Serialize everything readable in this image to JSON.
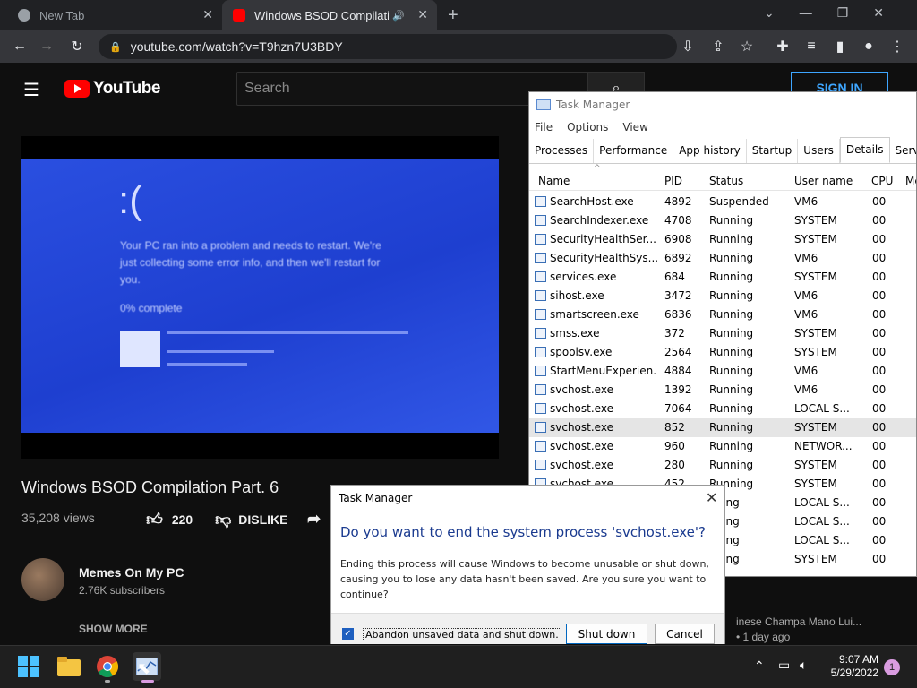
{
  "browser": {
    "tabs": [
      {
        "title": "New Tab",
        "close": "✕"
      },
      {
        "title": "Windows BSOD Compilation",
        "close": "✕"
      }
    ],
    "new_tab": "+",
    "address": "youtube.com/watch?v=T9hzn7U3BDY",
    "window_controls": [
      "⌄",
      "—",
      "❐",
      "✕"
    ]
  },
  "youtube": {
    "logo": "YouTube",
    "search_placeholder": "Search",
    "signin": "SIGN IN",
    "video_title": "Windows BSOD Compilation Part. 6",
    "views": "35,208 views",
    "likes": "220",
    "dislike": "DISLIKE",
    "channel": "Memes On My PC",
    "subscribers": "2.76K subscribers",
    "show_more": "SHOW MORE",
    "side_fragment_title": "inese Champa Mano Lui...",
    "side_fragment_age": "• 1 day ago",
    "bsod": {
      "face": ":(",
      "line1": "Your PC ran into a problem and needs to restart. We're",
      "line2": "just collecting some error info, and then we'll restart for",
      "line3": "you.",
      "progress": "0% complete"
    }
  },
  "task_manager": {
    "title": "Task Manager",
    "menu": [
      "File",
      "Options",
      "View"
    ],
    "tabs": [
      "Processes",
      "Performance",
      "App history",
      "Startup",
      "Users",
      "Details",
      "Services"
    ],
    "active_tab": "Details",
    "columns": [
      "Name",
      "PID",
      "Status",
      "User name",
      "CPU",
      "Me"
    ],
    "rows": [
      {
        "name": "SearchHost.exe",
        "pid": "4892",
        "status": "Suspended",
        "user": "VM6",
        "cpu": "00"
      },
      {
        "name": "SearchIndexer.exe",
        "pid": "4708",
        "status": "Running",
        "user": "SYSTEM",
        "cpu": "00"
      },
      {
        "name": "SecurityHealthSer...",
        "pid": "6908",
        "status": "Running",
        "user": "SYSTEM",
        "cpu": "00"
      },
      {
        "name": "SecurityHealthSys...",
        "pid": "6892",
        "status": "Running",
        "user": "VM6",
        "cpu": "00"
      },
      {
        "name": "services.exe",
        "pid": "684",
        "status": "Running",
        "user": "SYSTEM",
        "cpu": "00"
      },
      {
        "name": "sihost.exe",
        "pid": "3472",
        "status": "Running",
        "user": "VM6",
        "cpu": "00"
      },
      {
        "name": "smartscreen.exe",
        "pid": "6836",
        "status": "Running",
        "user": "VM6",
        "cpu": "00"
      },
      {
        "name": "smss.exe",
        "pid": "372",
        "status": "Running",
        "user": "SYSTEM",
        "cpu": "00"
      },
      {
        "name": "spoolsv.exe",
        "pid": "2564",
        "status": "Running",
        "user": "SYSTEM",
        "cpu": "00"
      },
      {
        "name": "StartMenuExperien...",
        "pid": "4884",
        "status": "Running",
        "user": "VM6",
        "cpu": "00"
      },
      {
        "name": "svchost.exe",
        "pid": "1392",
        "status": "Running",
        "user": "VM6",
        "cpu": "00"
      },
      {
        "name": "svchost.exe",
        "pid": "7064",
        "status": "Running",
        "user": "LOCAL S...",
        "cpu": "00"
      },
      {
        "name": "svchost.exe",
        "pid": "852",
        "status": "Running",
        "user": "SYSTEM",
        "cpu": "00",
        "selected": true
      },
      {
        "name": "svchost.exe",
        "pid": "960",
        "status": "Running",
        "user": "NETWOR...",
        "cpu": "00"
      },
      {
        "name": "svchost.exe",
        "pid": "280",
        "status": "Running",
        "user": "SYSTEM",
        "cpu": "00"
      },
      {
        "name": "svchost.exe",
        "pid": "452",
        "status": "Running",
        "user": "SYSTEM",
        "cpu": "00"
      },
      {
        "name": "",
        "pid": "",
        "status": "nning",
        "user": "LOCAL S...",
        "cpu": "00"
      },
      {
        "name": "",
        "pid": "",
        "status": "nning",
        "user": "LOCAL S...",
        "cpu": "00"
      },
      {
        "name": "",
        "pid": "",
        "status": "nning",
        "user": "LOCAL S...",
        "cpu": "00"
      },
      {
        "name": "",
        "pid": "",
        "status": "nning",
        "user": "SYSTEM",
        "cpu": "00"
      }
    ]
  },
  "dialog": {
    "title": "Task Manager",
    "question": "Do you want to end the system process 'svchost.exe'?",
    "body": "Ending this process will cause Windows to become unusable or shut down, causing you to lose any data hasn't been saved. Are you sure you want to continue?",
    "checkbox_label": "Abandon unsaved data and shut down.",
    "checkbox_checked": true,
    "shutdown": "Shut down",
    "cancel": "Cancel"
  },
  "taskbar": {
    "time": "9:07 AM",
    "date": "5/29/2022",
    "notifications": "1"
  }
}
